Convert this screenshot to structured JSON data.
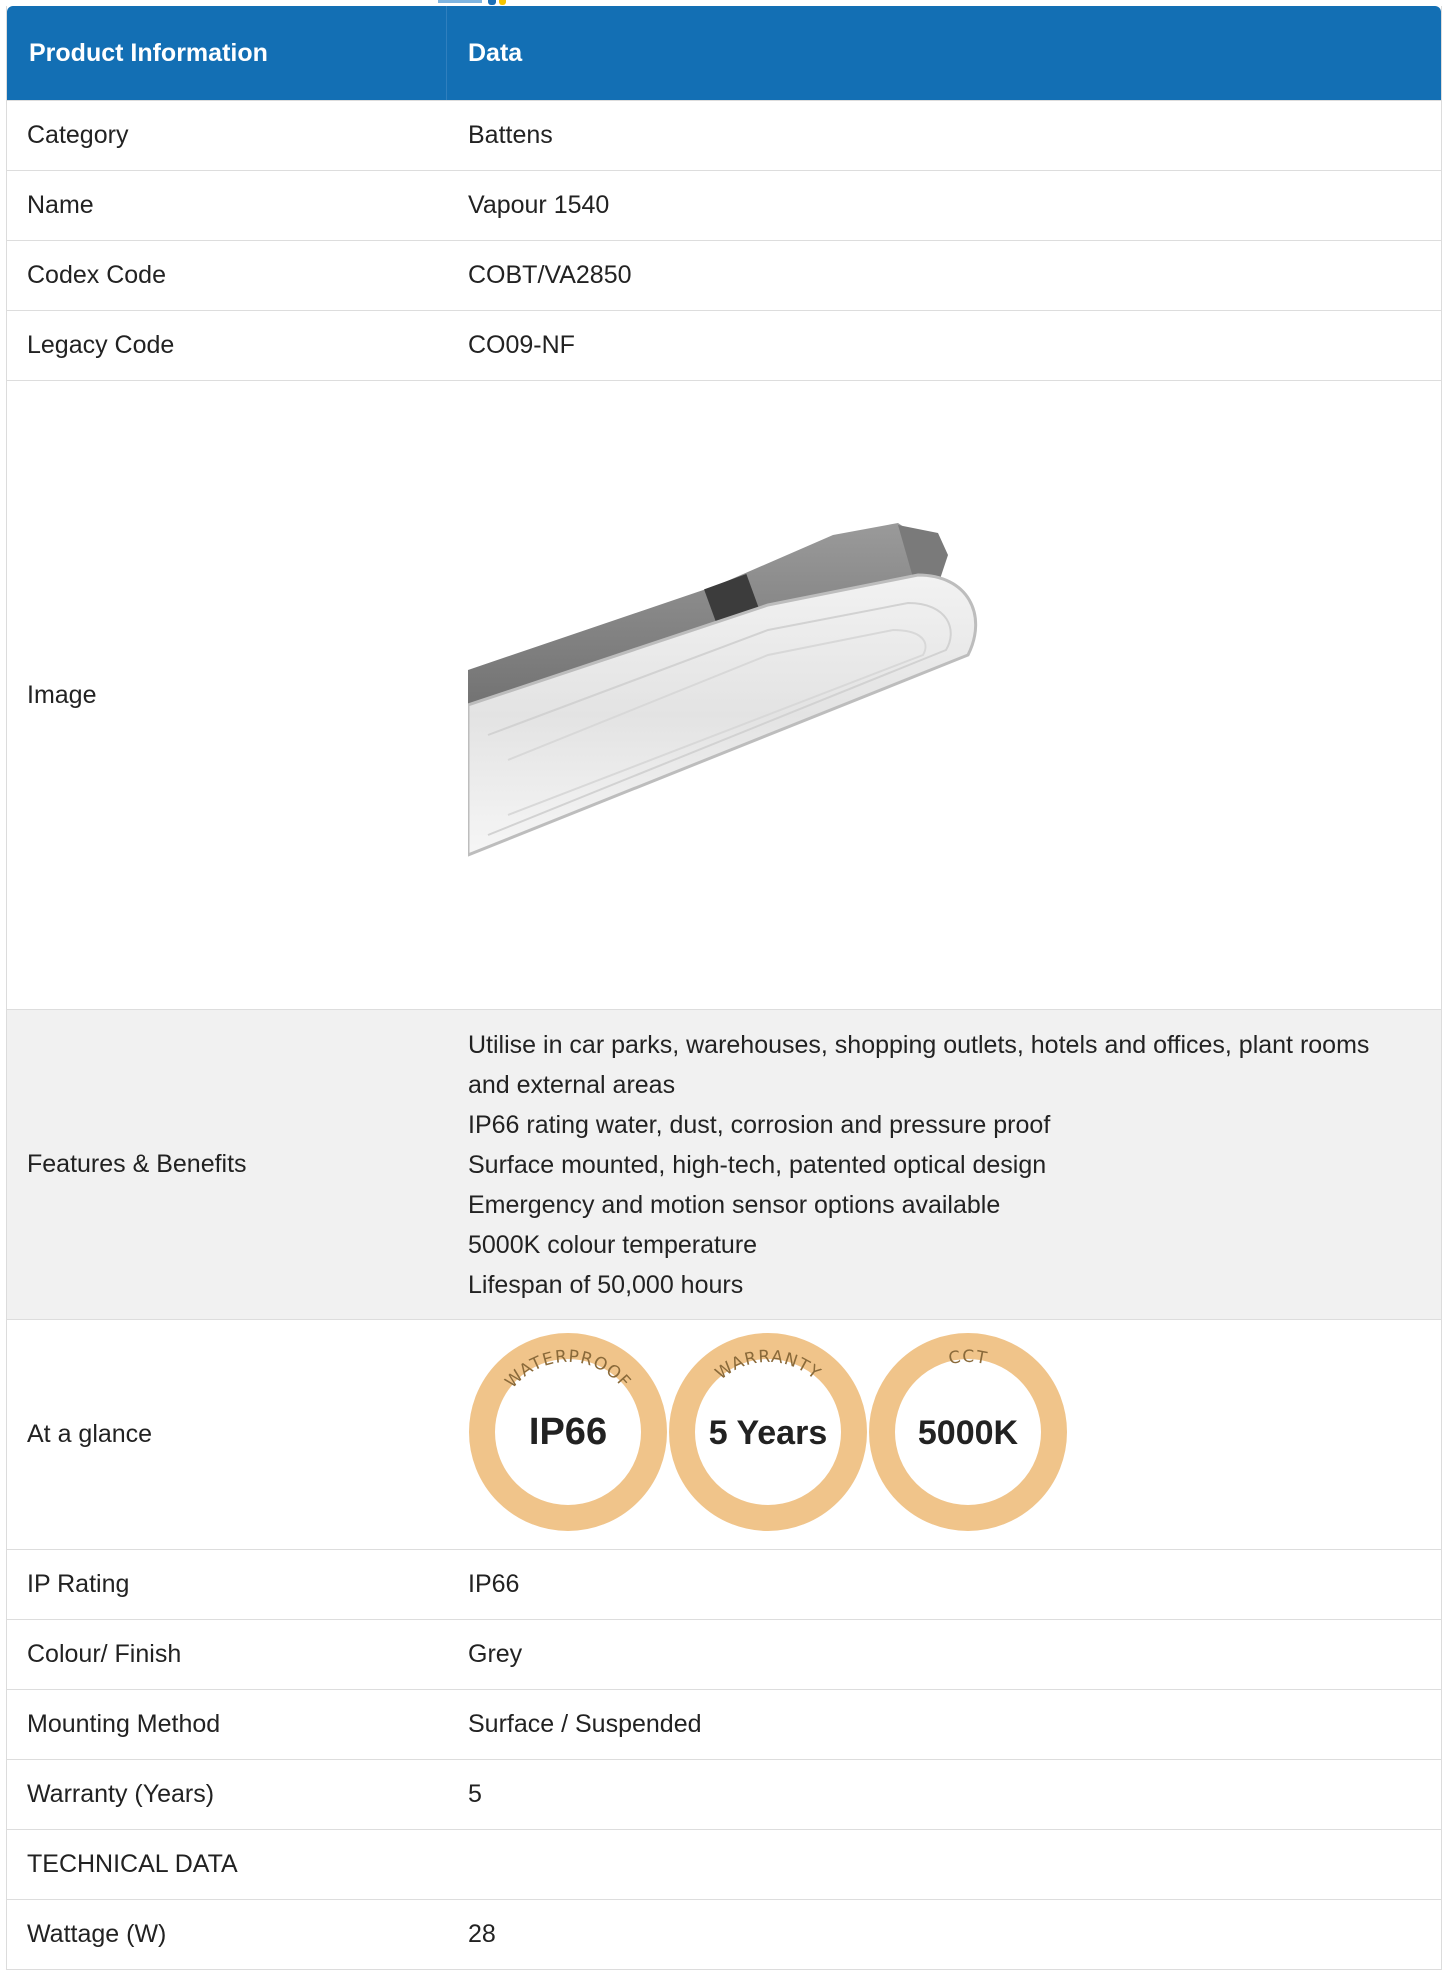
{
  "header": {
    "col1": "Product Information",
    "col2": "Data"
  },
  "rows_top": [
    {
      "label": "Category",
      "value": "Battens"
    },
    {
      "label": "Name",
      "value": "Vapour 1540"
    },
    {
      "label": "Codex Code",
      "value": "COBT/VA2850"
    },
    {
      "label": "Legacy Code",
      "value": "CO09-NF"
    }
  ],
  "image_row": {
    "label": "Image"
  },
  "features": {
    "label": "Features & Benefits",
    "items": [
      "Utilise in car parks, warehouses, shopping outlets, hotels and offices, plant rooms and external areas",
      "IP66 rating water, dust, corrosion and pressure proof",
      "Surface mounted, high-tech, patented optical design",
      "Emergency and motion sensor options available",
      "5000K colour temperature",
      "Lifespan of 50,000 hours"
    ]
  },
  "glance": {
    "label": "At a glance",
    "badges": [
      {
        "title": "WATERPROOF",
        "value": "IP66"
      },
      {
        "title": "WARRANTY",
        "value": "5 Years"
      },
      {
        "title": "CCT",
        "value": "5000K"
      }
    ],
    "badge_color": "#f0c48a"
  },
  "rows_bottom": [
    {
      "label": "IP Rating",
      "value": "IP66"
    },
    {
      "label": "Colour/ Finish",
      "value": "Grey"
    },
    {
      "label": "Mounting Method",
      "value": "Surface / Suspended"
    },
    {
      "label": "Warranty (Years)",
      "value": "5"
    },
    {
      "label": "TECHNICAL DATA",
      "value": ""
    },
    {
      "label": "Wattage (W)",
      "value": "28"
    }
  ],
  "colors": {
    "header_bg": "#136fb4",
    "row_alt": "#f1f1f1"
  }
}
